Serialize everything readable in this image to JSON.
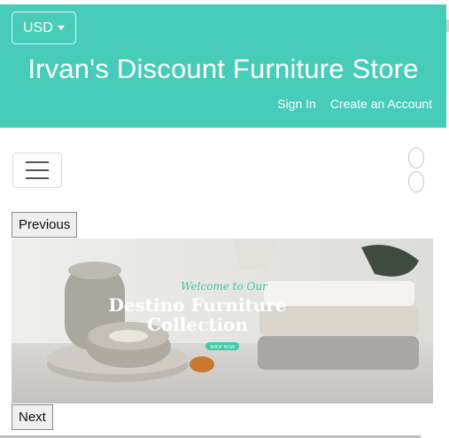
{
  "header": {
    "currency": "USD",
    "title": "Irvan's Discount Furniture Store",
    "sign_in": "Sign In",
    "create_account": "Create an Account"
  },
  "carousel": {
    "previous_label": "Previous",
    "next_label": "Next",
    "slide": {
      "script_line": "Welcome to Our",
      "title_line1": "Destino Furniture",
      "title_line2": "Collection",
      "button": "SHOP NOW"
    }
  },
  "colors": {
    "header_bg": "#46ccb8",
    "accent": "#3ec9a7"
  }
}
